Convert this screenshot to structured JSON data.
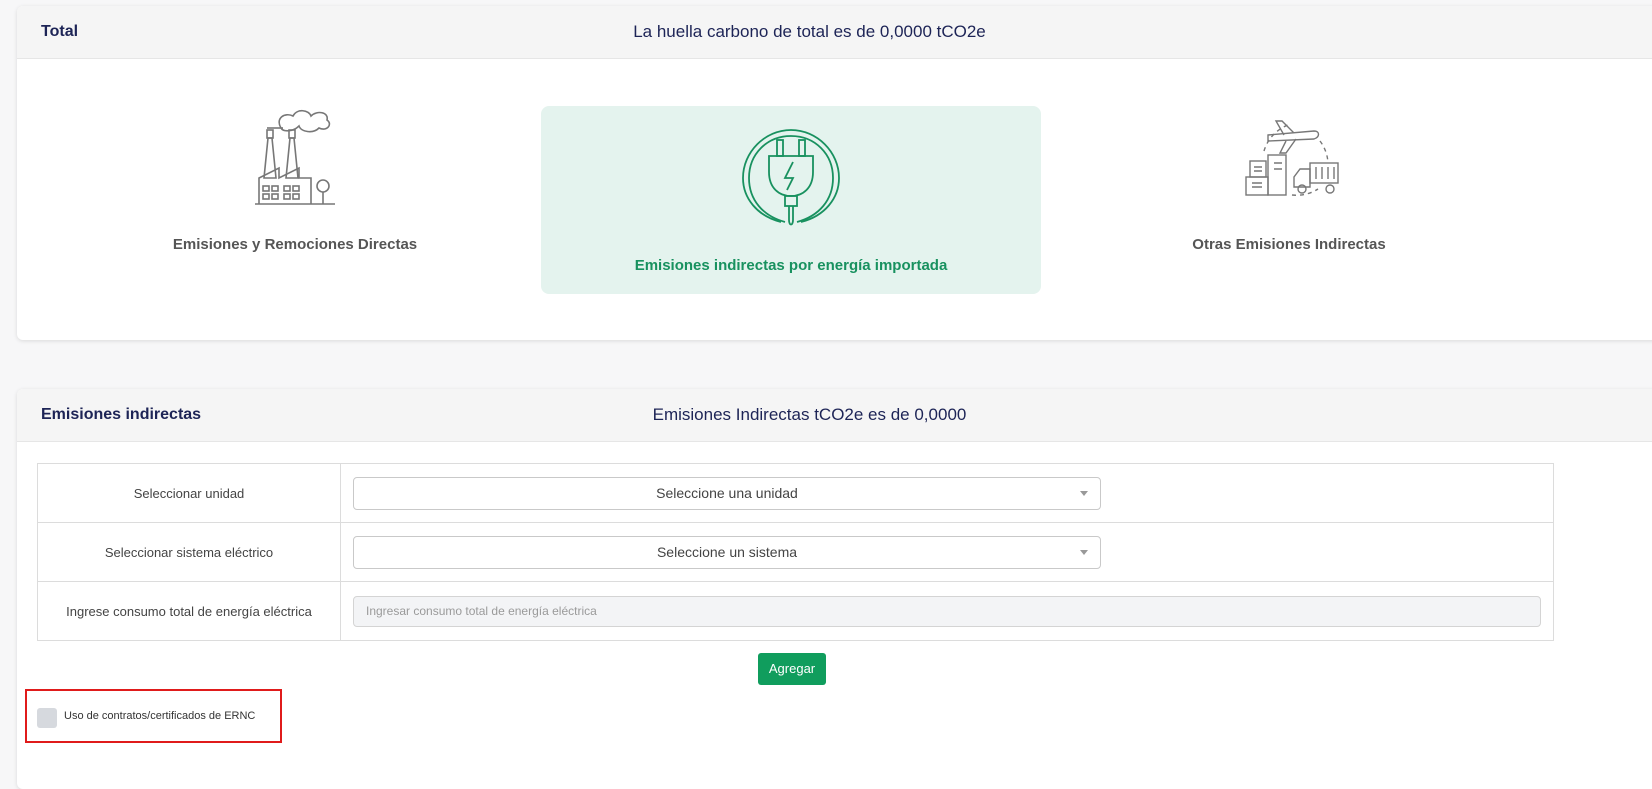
{
  "total_card": {
    "title": "Total",
    "summary": "La huella carbono de total es de 0,0000 tCO2e",
    "options": [
      {
        "label": "Emisiones y Remociones Directas",
        "icon": "factory-icon"
      },
      {
        "label": "Emisiones indirectas por energía importada",
        "icon": "plug-icon",
        "selected": true
      },
      {
        "label": "Otras Emisiones Indirectas",
        "icon": "transport-logistics-icon"
      }
    ]
  },
  "indirect_card": {
    "title": "Emisiones indirectas",
    "summary": "Emisiones Indirectas tCO2e es de 0,0000",
    "rows": [
      {
        "label": "Seleccionar unidad",
        "select_value": "Seleccione una unidad"
      },
      {
        "label": "Seleccionar sistema eléctrico",
        "select_value": "Seleccione un sistema"
      },
      {
        "label": "Ingrese consumo total de energía eléctrica",
        "placeholder": "Ingresar consumo total de energía eléctrica"
      }
    ],
    "add_button": "Agregar",
    "checkbox_label": "Uso de contratos/certificados de ERNC"
  },
  "colors": {
    "accent_green": "#109d5d",
    "selected_bg": "#e4f3ee",
    "header_text": "#1d2456",
    "highlight_border": "#e01b1b"
  }
}
